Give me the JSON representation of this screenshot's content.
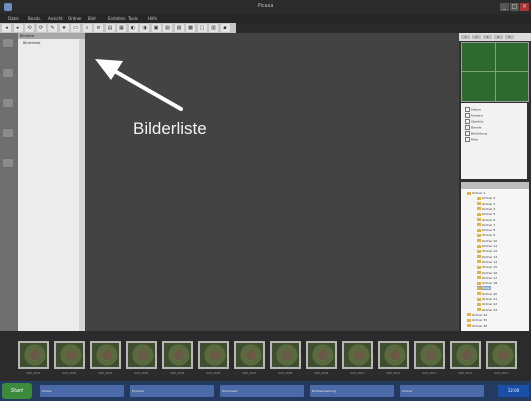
{
  "window": {
    "title": "Picasa",
    "minimize_label": "_",
    "maximize_label": "□",
    "close_label": "×"
  },
  "menu": [
    "Datei",
    "Bearb.",
    "Ansicht",
    "Ordner",
    "Bild",
    "Erstellen",
    "Tools",
    "Hilfe"
  ],
  "toolbar": {
    "buttons": [
      "◂",
      "▸",
      "⟲",
      "⟳",
      "✎",
      "★",
      "▭",
      "⌕",
      "≡",
      "▤",
      "▦",
      "◐",
      "◑",
      "▣",
      "▧",
      "▨",
      "▩",
      "▢",
      "▥",
      "▪"
    ]
  },
  "left_strip": {
    "icon_count": 5
  },
  "image_list": {
    "header": "Bildliste",
    "first_item": "Bilderliste"
  },
  "canvas": {
    "annotation_text": "Bilderliste"
  },
  "navigator": {
    "tabs": [
      "1",
      "2",
      "3",
      "4",
      "5"
    ]
  },
  "info_panel": {
    "rows": [
      "Datum",
      "Kamera",
      "Objektiv",
      "Blende",
      "Belichtung",
      "Filter"
    ]
  },
  "folders": {
    "items": [
      {
        "label": "Ordner 1",
        "level": 0
      },
      {
        "label": "Ordner 2",
        "level": 1
      },
      {
        "label": "Ordner 3",
        "level": 1
      },
      {
        "label": "Ordner 4",
        "level": 1
      },
      {
        "label": "Ordner 5",
        "level": 1
      },
      {
        "label": "Ordner 6",
        "level": 1
      },
      {
        "label": "Ordner 7",
        "level": 1
      },
      {
        "label": "Ordner 8",
        "level": 1
      },
      {
        "label": "Ordner 9",
        "level": 1
      },
      {
        "label": "Ordner 10",
        "level": 1
      },
      {
        "label": "Ordner 11",
        "level": 1
      },
      {
        "label": "Ordner 12",
        "level": 1
      },
      {
        "label": "Ordner 13",
        "level": 1
      },
      {
        "label": "Ordner 14",
        "level": 1
      },
      {
        "label": "Ordner 15",
        "level": 1
      },
      {
        "label": "Ordner 16",
        "level": 1
      },
      {
        "label": "Ordner 17",
        "level": 1
      },
      {
        "label": "Ordner 18",
        "level": 1
      },
      {
        "label": "Bilder",
        "level": 1,
        "selected": true
      },
      {
        "label": "Ordner 20",
        "level": 1
      },
      {
        "label": "Ordner 21",
        "level": 1
      },
      {
        "label": "Ordner 22",
        "level": 1
      },
      {
        "label": "Ordner 23",
        "level": 1
      },
      {
        "label": "Ordner 24",
        "level": 0
      },
      {
        "label": "Ordner 25",
        "level": 0
      },
      {
        "label": "Ordner 26",
        "level": 0
      }
    ]
  },
  "filmstrip": {
    "thumbnails": [
      {
        "caption": "IMG_0001"
      },
      {
        "caption": "IMG_0002"
      },
      {
        "caption": "IMG_0003"
      },
      {
        "caption": "IMG_0004"
      },
      {
        "caption": "IMG_0005"
      },
      {
        "caption": "IMG_0006"
      },
      {
        "caption": "IMG_0007"
      },
      {
        "caption": "IMG_0008"
      },
      {
        "caption": "IMG_0009"
      },
      {
        "caption": "IMG_0010"
      },
      {
        "caption": "IMG_0011"
      },
      {
        "caption": "IMG_0012"
      },
      {
        "caption": "IMG_0013"
      },
      {
        "caption": "IMG_0014"
      }
    ]
  },
  "taskbar": {
    "start_label": "Start",
    "tasks": [
      "Picasa",
      "Explorer",
      "Dokument",
      "Bildbearbeitung",
      "Ordner"
    ],
    "clock": "12:00"
  },
  "colors": {
    "canvas_bg": "#434343",
    "preview_green": "#2e6a2e",
    "folder_yellow": "#e6b43c",
    "taskbar_blue": "#243a60"
  }
}
